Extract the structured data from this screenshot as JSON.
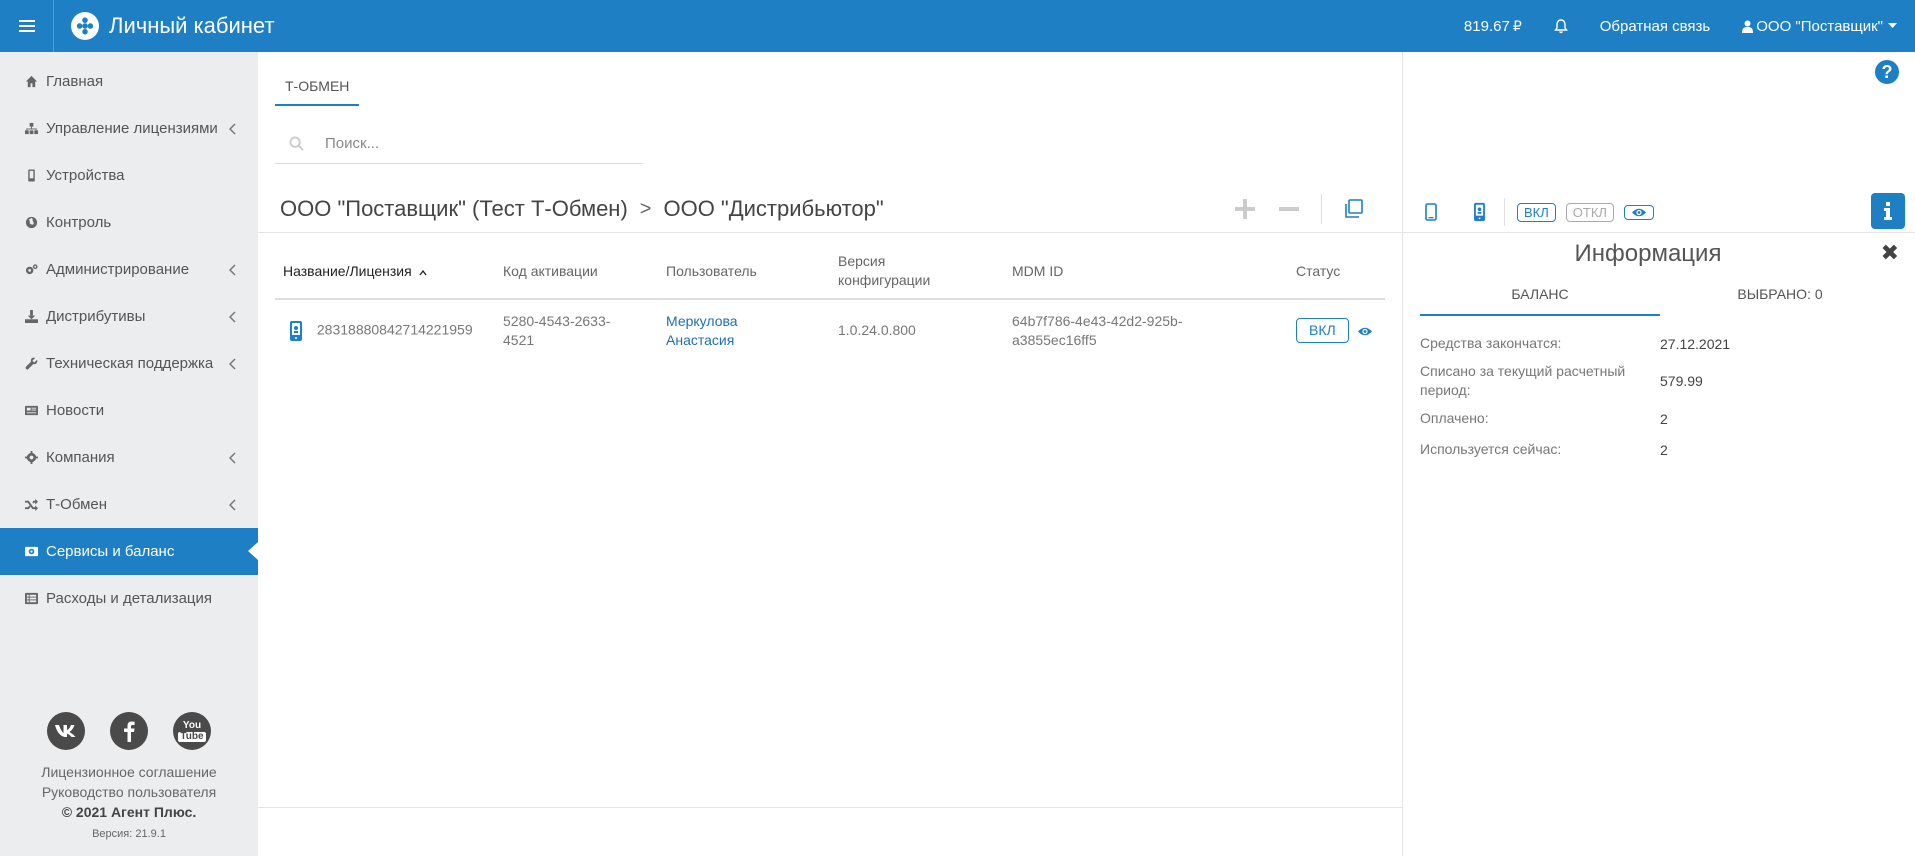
{
  "header": {
    "title": "Личный кабинет",
    "balance": "819.67",
    "feedback": "Обратная связь",
    "account": "ООО \"Поставщик\""
  },
  "sidebar": {
    "items": [
      {
        "label": "Главная",
        "icon": "home-icon"
      },
      {
        "label": "Управление лицензиями",
        "icon": "sitemap-icon",
        "chevron": true
      },
      {
        "label": "Устройства",
        "icon": "mobile-icon"
      },
      {
        "label": "Контроль",
        "icon": "globe-icon"
      },
      {
        "label": "Администрирование",
        "icon": "cogs-icon",
        "chevron": true
      },
      {
        "label": "Дистрибутивы",
        "icon": "download-icon",
        "chevron": true
      },
      {
        "label": "Техническая поддержка",
        "icon": "wrench-icon",
        "chevron": true
      },
      {
        "label": "Новости",
        "icon": "newspaper-icon"
      },
      {
        "label": "Компания",
        "icon": "gear-icon",
        "chevron": true
      },
      {
        "label": "Т-Обмен",
        "icon": "shuffle-icon",
        "chevron": true
      },
      {
        "label": "Сервисы и баланс",
        "icon": "money-icon",
        "active": true
      },
      {
        "label": "Расходы и детализация",
        "icon": "list-icon"
      }
    ],
    "footer": {
      "license": "Лицензионное соглашение",
      "guide": "Руководство пользователя",
      "copyright": "© 2021 Агент Плюс.",
      "version": "Версия: 21.9.1",
      "youtube_top": "You",
      "youtube_bottom": "Tube"
    }
  },
  "main": {
    "tab": "Т-ОБМЕН",
    "search_placeholder": "Поиск...",
    "breadcrumb": {
      "first": "ООО \"Поставщик\" (Тест Т-Обмен)",
      "separator": ">",
      "second": "ООО \"Дистрибьютор\""
    },
    "columns": {
      "name": "Название/Лицензия",
      "code": "Код активации",
      "user": "Пользователь",
      "version_1": "Версия",
      "version_2": "конфигурации",
      "mdm": "MDM ID",
      "status": "Статус"
    },
    "rows": [
      {
        "name": "28318880842714221959",
        "code_1": "5280-4543-2633-",
        "code_2": "4521",
        "user_1": "Меркулова",
        "user_2": "Анастасия",
        "version": "1.0.24.0.800",
        "mdm_1": "64b7f786-4e43-42d2-925b-",
        "mdm_2": "a3855ec16ff5",
        "status": "ВКЛ"
      }
    ]
  },
  "panel": {
    "on_label": "ВКЛ",
    "off_label": "ОТКЛ",
    "title": "Информация",
    "tab_balance": "БАЛАНС",
    "tab_selected": "ВЫБРАНО: 0",
    "rows": [
      {
        "key": "Средства закончатся:",
        "value": "27.12.2021"
      },
      {
        "key": "Списано за текущий расчетный период:",
        "value": "579.99"
      },
      {
        "key": "Оплачено:",
        "value": "2"
      },
      {
        "key": "Используется сейчас:",
        "value": "2"
      }
    ]
  },
  "colors": {
    "accent": "#1f7fc4",
    "sidebar_bg": "#ecedee",
    "social_icon_bg": "#4a4a4a"
  }
}
